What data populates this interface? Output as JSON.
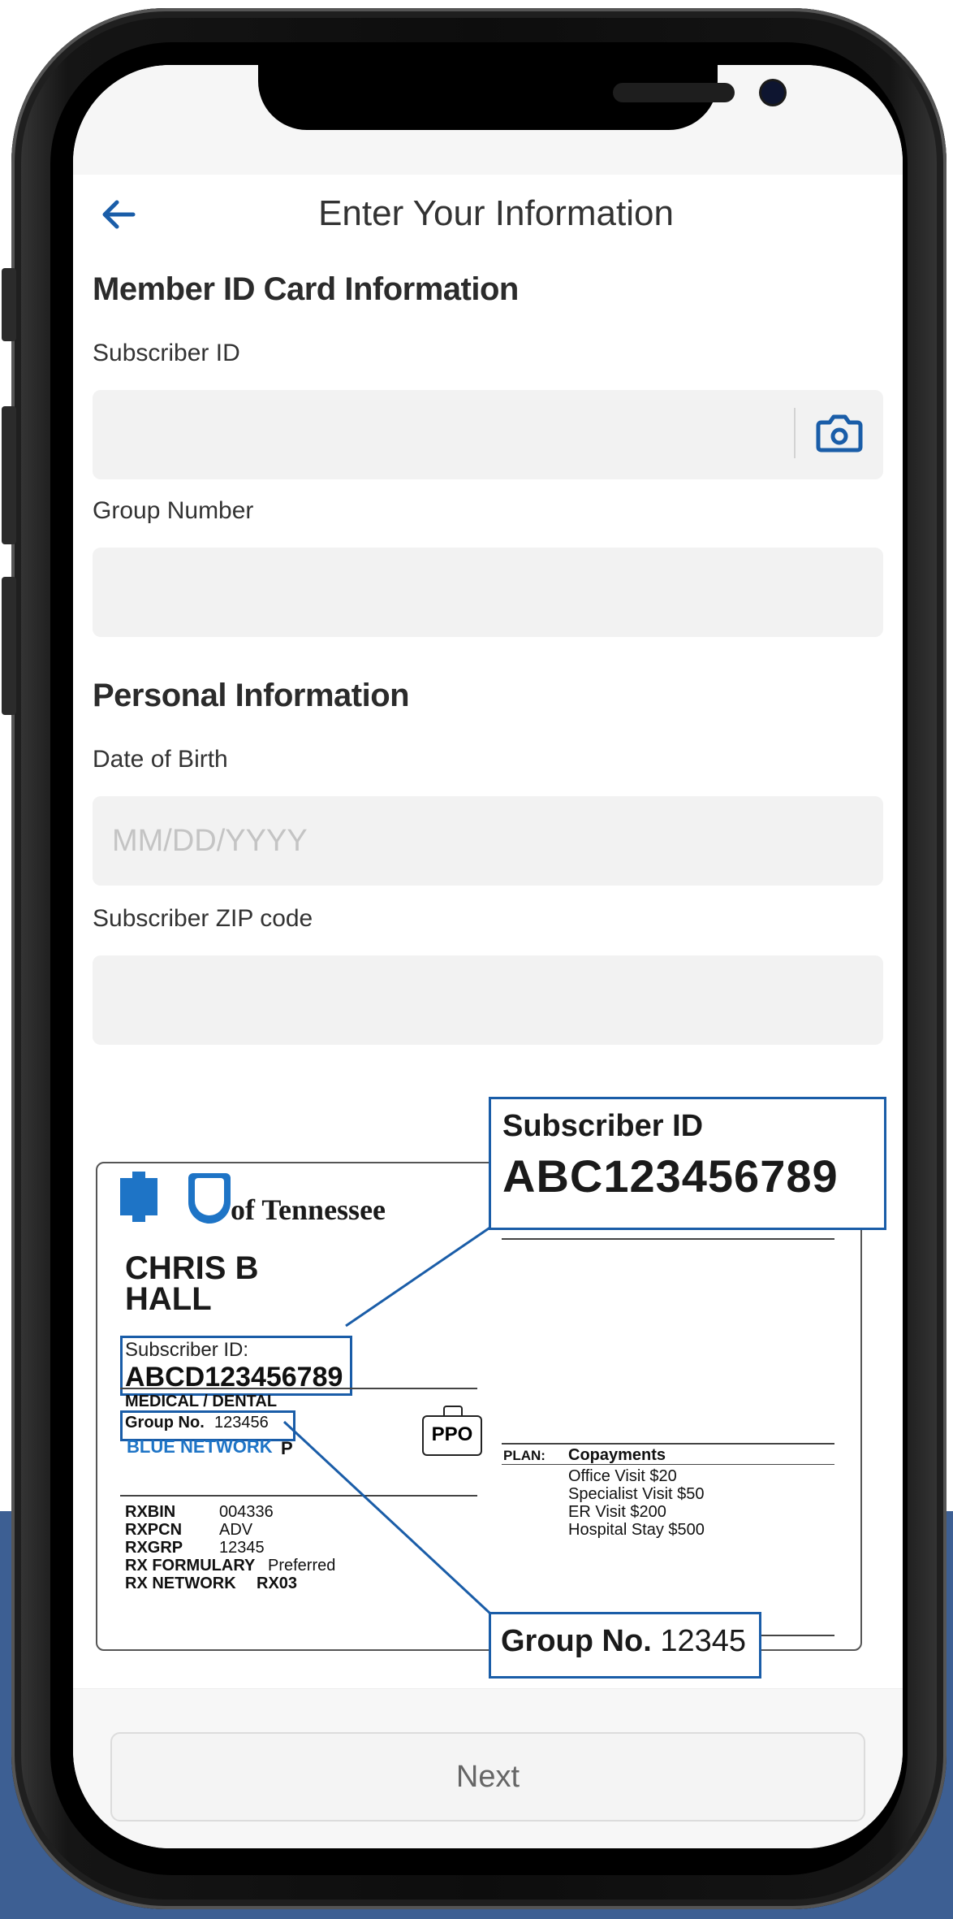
{
  "nav": {
    "back_icon": "arrow-left-icon",
    "title": "Enter Your Information"
  },
  "member_section": {
    "title": "Member ID Card Information",
    "subscriber_id_label": "Subscriber ID",
    "subscriber_id_value": "",
    "camera_icon": "camera-icon",
    "group_number_label": "Group Number",
    "group_number_value": ""
  },
  "personal_section": {
    "title": "Personal Information",
    "dob_label": "Date of Birth",
    "dob_placeholder": "MM/DD/YYYY",
    "zip_label": "Subscriber ZIP code",
    "zip_value": ""
  },
  "sample_card": {
    "brand_suffix": "of Tennessee",
    "member_name_line1": "CHRIS B",
    "member_name_line2": "HALL",
    "subscriber_id_label": "Subscriber ID:",
    "subscriber_id_value": "ABCD123456789",
    "coverage": "MEDICAL / DENTAL",
    "group_label": "Group No.",
    "group_value": "123456",
    "network": "BLUE NETWORK",
    "network_suffix": "P",
    "ppo": "PPO",
    "rx": [
      {
        "key": "RXBIN",
        "value": "004336"
      },
      {
        "key": "RXPCN",
        "value": "ADV"
      },
      {
        "key": "RXGRP",
        "value": "12345"
      },
      {
        "key": "RX FORMULARY",
        "value": "Preferred"
      },
      {
        "key": "RX NETWORK",
        "value": "RX03"
      }
    ],
    "plan_label": "PLAN:",
    "plan_title": "Copayments",
    "copays": [
      "Office Visit $20",
      "Specialist Visit $50",
      "ER Visit $200",
      "Hospital Stay $500"
    ]
  },
  "callouts": {
    "subscriber_id_label": "Subscriber ID",
    "subscriber_id_value": "ABC123456789",
    "group_label": "Group No.",
    "group_value": "12345"
  },
  "footer": {
    "next_label": "Next"
  },
  "colors": {
    "accent": "#1a5da8",
    "brand_blue": "#1e74c6",
    "page_blue": "#3d5f93"
  }
}
